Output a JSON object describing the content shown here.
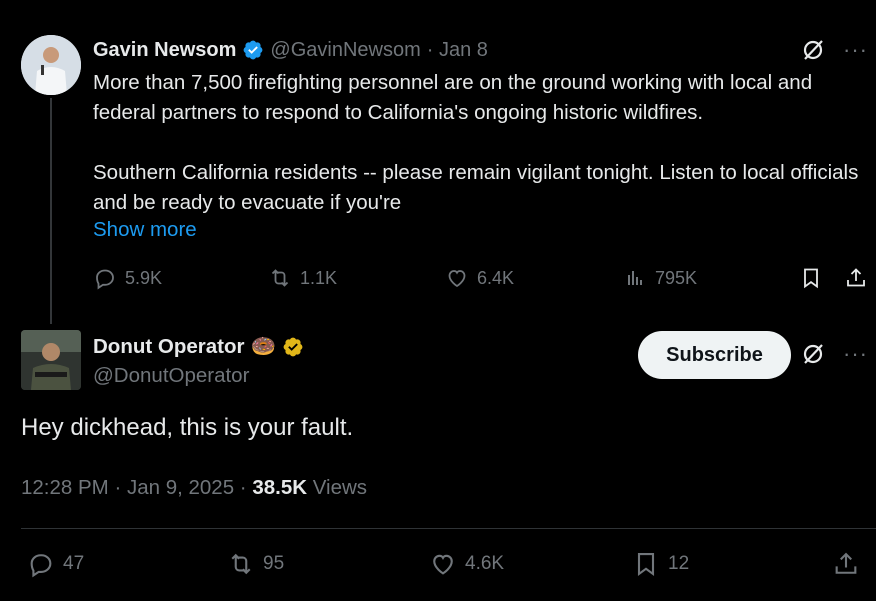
{
  "parent": {
    "name": "Gavin Newsom",
    "handle": "@GavinNewsom",
    "date": "· Jan 8",
    "body": "More than 7,500 firefighting personnel are on the ground working with local and federal partners to respond to California's ongoing historic wildfires.\n\nSouthern California residents -- please remain vigilant tonight. Listen to local officials and be ready to evacuate if you're",
    "show_more": "Show more",
    "stats": {
      "replies": "5.9K",
      "reposts": "1.1K",
      "likes": "6.4K",
      "views": "795K"
    },
    "verified_color": "#1d9bf0"
  },
  "reply": {
    "name": "Donut Operator",
    "emoji": "🍩",
    "handle": "@DonutOperator",
    "subscribe_label": "Subscribe",
    "body": "Hey dickhead, this is your fault.",
    "time": "12:28 PM · Jan 9, 2025 · ",
    "views_count": "38.5K",
    "views_label": " Views",
    "stats": {
      "replies": "47",
      "reposts": "95",
      "likes": "4.6K",
      "bookmarks": "12"
    },
    "verified_color": "#e2b719"
  },
  "colors": {
    "background": "#000000",
    "text": "#e7e9ea",
    "muted": "#71767b",
    "link": "#1d9bf0"
  },
  "icons": [
    "reply-icon",
    "repost-icon",
    "like-icon",
    "views-icon",
    "bookmark-icon",
    "share-icon",
    "grok-icon",
    "more-icon",
    "verified-badge-icon"
  ]
}
